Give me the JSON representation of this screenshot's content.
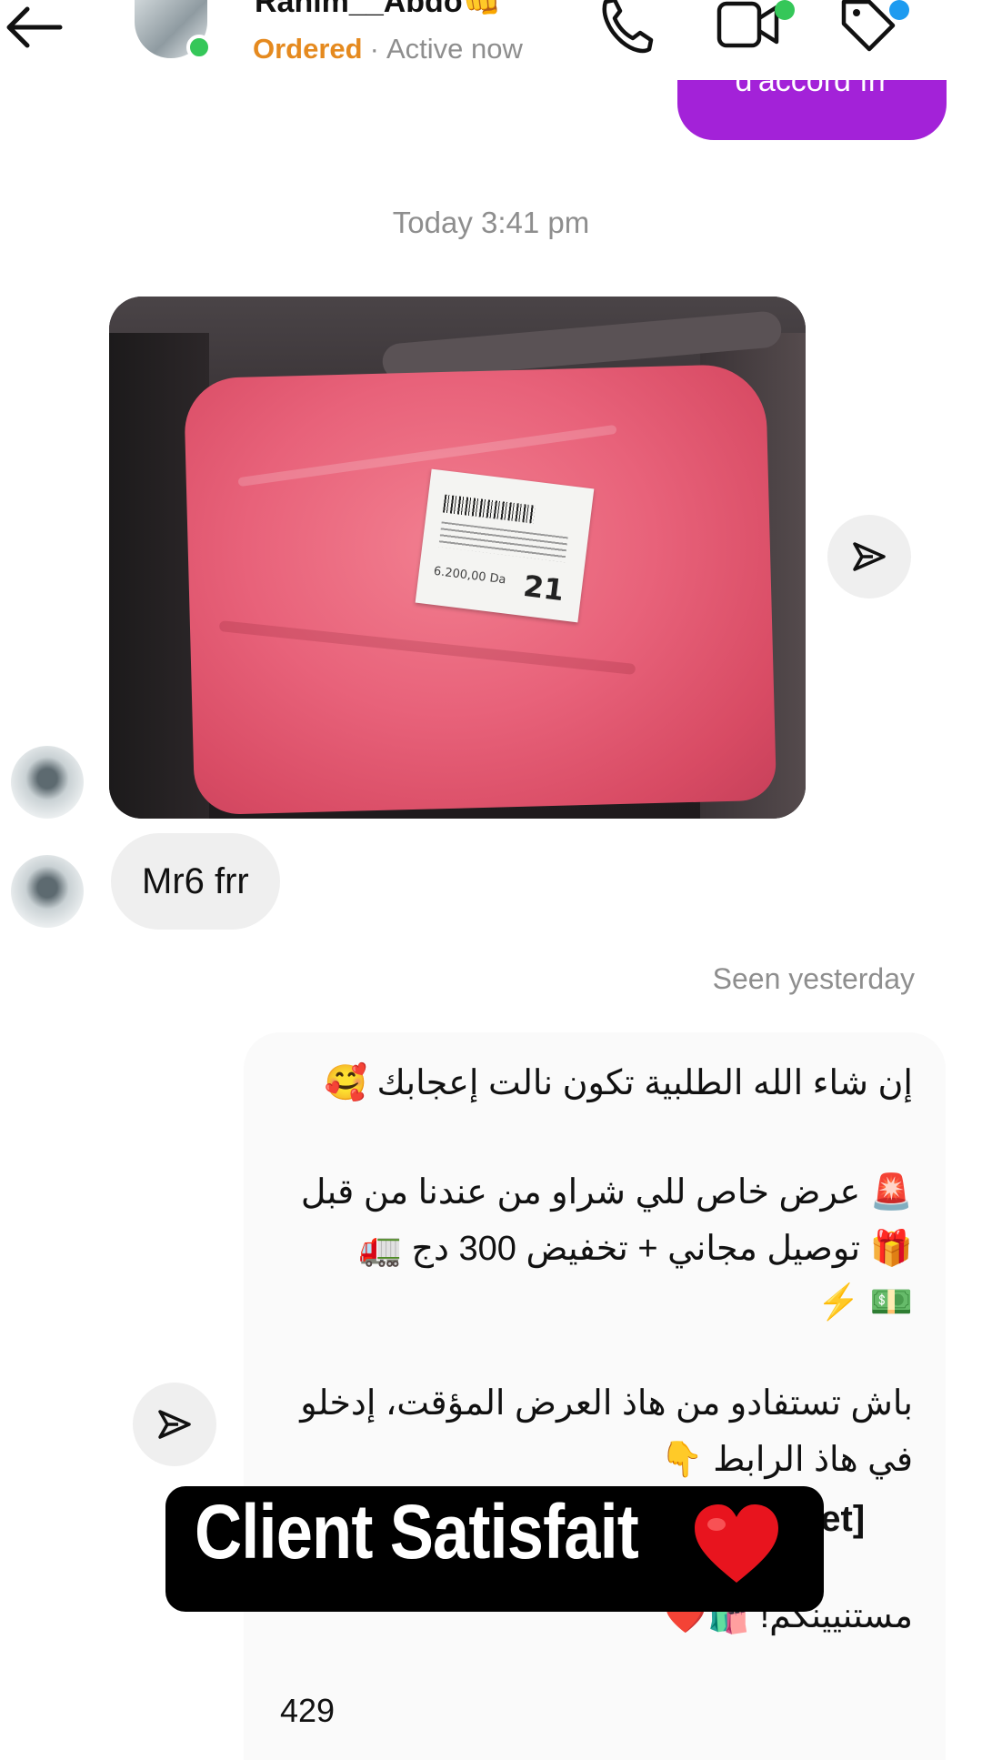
{
  "header": {
    "name": "Rahim__Abdo👊",
    "status_tag": "Ordered",
    "separator": "·",
    "activity": "Active now"
  },
  "thread": {
    "previous_sent_text": "d'accord frr",
    "timestamp": "Today 3:41 pm",
    "photo_label_price": "6.200,00 Da",
    "photo_label_number": "21",
    "received_text": "Mr6 frr",
    "seen_label": "Seen yesterday",
    "reply": {
      "line1": "إن شاء الله الطلبية تكون نالت إعجابك 🥰",
      "line2": "🚨 عرض خاص للي شراو من عندنا من قبل",
      "line3": "🎁 توصيل مجاني + تخفيض 300 دج 🚛",
      "line4": "💵 ⚡",
      "line5": "باش تستفادو من هاذ العرض المؤقت، إدخلو",
      "line6": "في هاذ الرابط 👇",
      "line7_fragment": "ket]",
      "line8": "مستنيينكم! 🛍️❤️",
      "count": "429"
    }
  },
  "overlay": {
    "caption": "Client Satisfait",
    "emoji": "❤️"
  },
  "colors": {
    "sent_bubble": "#a322d8",
    "ordered_tag": "#e58a1f",
    "online": "#35c759",
    "received_bubble": "#efefef"
  },
  "icons": [
    "back-arrow-icon",
    "phone-icon",
    "video-icon",
    "tag-icon",
    "share-icon",
    "heart-icon"
  ]
}
